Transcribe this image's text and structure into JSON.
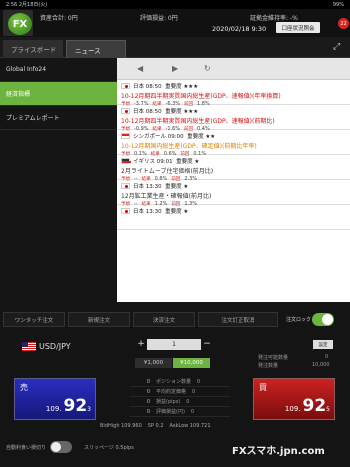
{
  "status": {
    "time": "2:56",
    "date": "2月18日(火)",
    "battery": "99%"
  },
  "top": {
    "logo": "FX",
    "total_assets": "資産合計: 0円",
    "unrealized": "評価損益: 0円",
    "margin_ratio": "証拠金維持率: -%",
    "datetime": "2020/02/18 9:30",
    "account_button": "口座状況照会",
    "badge": "22"
  },
  "tabs": [
    "プライスボード",
    "ニュース"
  ],
  "sidebar": [
    "Global Info24",
    "経済指標",
    "プレミアムレポート"
  ],
  "news": [
    {
      "flag": "jp",
      "head": "日本 08:50",
      "importance": "重要度 ★★★",
      "title": "10-12月期四半期実質国内総生産(GDP、速報値)(年率換算)",
      "color": "red",
      "forecast": "予想",
      "f": "-3.7%",
      "result": "結果",
      "r": "-6.3%",
      "prev": "前回",
      "p": "1.8%"
    },
    {
      "flag": "jp",
      "head": "日本 08:50",
      "importance": "重要度 ★★★",
      "title": "10-12月期四半期実質国内総生産(GDP、速報値)(前期比)",
      "color": "red",
      "forecast": "予想",
      "f": "-0.9%",
      "result": "結果",
      "r": "-1.6%",
      "prev": "前回",
      "p": "0.4%"
    },
    {
      "flag": "sg",
      "head": "シンガポール 09:00",
      "importance": "重要度 ★★",
      "title": "10-12月期国内総生産(GDP、確定値)(前期比年率)",
      "color": "orange",
      "forecast": "予想",
      "f": "0.1%",
      "result": "結果",
      "r": "0.6%",
      "prev": "前回",
      "p": "0.1%"
    },
    {
      "flag": "uk",
      "head": "イギリス 09:01",
      "importance": "重要度 ★",
      "title": "2月ライトムーブ住宅価格(前月比)",
      "color": "dark",
      "forecast": "予想",
      "f": "--",
      "result": "結果",
      "r": "0.8%",
      "prev": "前回",
      "p": "2.3%"
    },
    {
      "flag": "jp",
      "head": "日本 13:30",
      "importance": "重要度 ★",
      "title": "12月鉱工業生産・確報値(前月比)",
      "color": "dark",
      "forecast": "予想",
      "f": "--",
      "result": "結果",
      "r": "1.2%",
      "prev": "前回",
      "p": "1.3%"
    },
    {
      "flag": "jp",
      "head": "日本 13:30",
      "importance": "重要度 ★",
      "title": "",
      "color": "dark",
      "forecast": "",
      "f": "",
      "result": "",
      "r": "",
      "prev": "",
      "p": ""
    }
  ],
  "panel": {
    "tabs": [
      "ワンタッチ注文",
      "新規注文",
      "決済注文",
      "注文訂正取消"
    ],
    "lock_label": "注文ロック",
    "pair": "USD/JPY",
    "stepper_value": "1",
    "lot1": "¥1,000",
    "lot2": "¥10,000",
    "setting": "設定",
    "order_avail_label": "発注可能数量",
    "order_avail": "0",
    "order_qty_label": "発注数量",
    "order_qty": "10,000",
    "sell_label": "売",
    "buy_label": "買",
    "sell_price": {
      "a": "109.",
      "b": "92",
      "c": "3"
    },
    "buy_price": {
      "a": "109.",
      "b": "92",
      "c": "5"
    },
    "rows": [
      {
        "n": "0",
        "label": "ポジション数量",
        "n2": "0"
      },
      {
        "n": "0",
        "label": "平均約定価格",
        "n2": "0"
      },
      {
        "n": "0",
        "label": "損益(pips)",
        "n2": "0"
      },
      {
        "n": "0",
        "label": "評価損益(円)",
        "n2": "0"
      }
    ],
    "bid_high": "BidHigh 109.960",
    "spread": "SP 0.2",
    "ask_low": "AskLow 109.721",
    "auto_label": "自動利食い損切り",
    "slippage": "スリッページ 0.5pips",
    "watermark": "FXスマホ.jpn.com"
  }
}
